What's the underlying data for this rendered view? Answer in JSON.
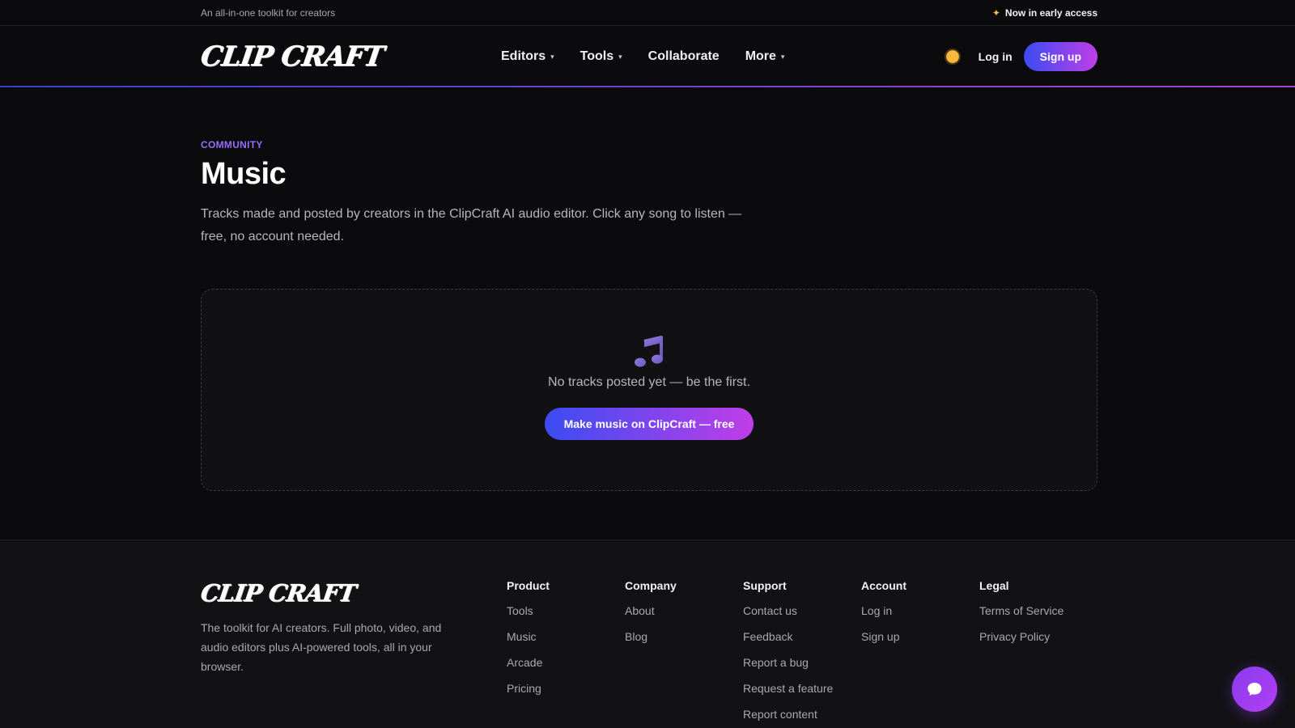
{
  "topbar": {
    "tagline": "An all-in-one toolkit for creators",
    "early_access": "Now in early access"
  },
  "brand": {
    "logo_text": "CLIP CRAFT"
  },
  "nav": {
    "items": [
      {
        "label": "Editors",
        "has_dropdown": true
      },
      {
        "label": "Tools",
        "has_dropdown": true
      },
      {
        "label": "Collaborate",
        "has_dropdown": false
      },
      {
        "label": "More",
        "has_dropdown": true
      }
    ],
    "login": "Log in",
    "signup": "Sign up",
    "theme_icon": "sun-icon"
  },
  "page": {
    "eyebrow": "COMMUNITY",
    "title": "Music",
    "description": "Tracks made and posted by creators in the ClipCraft AI audio editor. Click any song to listen — free, no account needed.",
    "empty_icon": "music-note-icon",
    "empty_text": "No tracks posted yet — be the first.",
    "cta": "Make music on ClipCraft — free"
  },
  "footer": {
    "logo_text": "CLIP CRAFT",
    "description": "The toolkit for AI creators. Full photo, video, and audio editors plus AI-powered tools, all in your browser.",
    "columns": [
      {
        "title": "Product",
        "links": [
          "Tools",
          "Music",
          "Arcade",
          "Pricing"
        ]
      },
      {
        "title": "Company",
        "links": [
          "About",
          "Blog"
        ]
      },
      {
        "title": "Support",
        "links": [
          "Contact us",
          "Feedback",
          "Report a bug",
          "Request a feature",
          "Report content"
        ]
      },
      {
        "title": "Account",
        "links": [
          "Log in",
          "Sign up"
        ]
      },
      {
        "title": "Legal",
        "links": [
          "Terms of Service",
          "Privacy Policy"
        ]
      }
    ]
  },
  "colors": {
    "background": "#0b0b0d",
    "accent_purple": "#9b6cff",
    "gradient_start": "#3b4cf2",
    "gradient_end": "#c03ee8"
  }
}
